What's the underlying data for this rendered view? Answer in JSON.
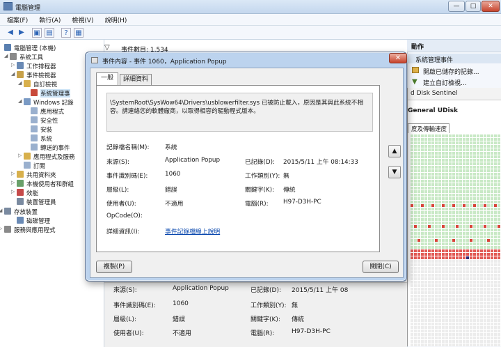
{
  "window": {
    "title": "電腦管理",
    "min": "—",
    "max": "□",
    "close": "✕"
  },
  "menu": [
    "檔案(F)",
    "執行(A)",
    "檢視(V)",
    "說明(H)"
  ],
  "tree": [
    {
      "label": "電腦管理 (本機)",
      "exp": ""
    },
    {
      "label": "系統工具",
      "exp": "◢"
    },
    {
      "label": "工作排程器",
      "exp": "▷"
    },
    {
      "label": "事件檢視器",
      "exp": "◢"
    },
    {
      "label": "自訂檢視",
      "exp": "◢"
    },
    {
      "label": "系統管理事",
      "exp": ""
    },
    {
      "label": "Windows 記錄",
      "exp": "◢"
    },
    {
      "label": "應用程式",
      "exp": ""
    },
    {
      "label": "安全性",
      "exp": ""
    },
    {
      "label": "安裝",
      "exp": ""
    },
    {
      "label": "系統",
      "exp": ""
    },
    {
      "label": "轉送的事件",
      "exp": ""
    },
    {
      "label": "應用程式及服務",
      "exp": "▷"
    },
    {
      "label": "訂閱",
      "exp": ""
    },
    {
      "label": "共用資料夾",
      "exp": "▷"
    },
    {
      "label": "本機使用者和群組",
      "exp": "▷"
    },
    {
      "label": "效能",
      "exp": "▷"
    },
    {
      "label": "裝置管理員",
      "exp": ""
    },
    {
      "label": "存放裝置",
      "exp": "◢"
    },
    {
      "label": "磁碟管理",
      "exp": ""
    },
    {
      "label": "服務與應用程式",
      "exp": "▷"
    }
  ],
  "list": {
    "header": "事件數目: 1,534"
  },
  "background_detail": {
    "source_label": "來源(S):",
    "source_value": "Application Popup",
    "logged_label": "已記錄(D):",
    "logged_value": "2015/5/11 上午 08",
    "eventid_label": "事件識別碼(E):",
    "eventid_value": "1060",
    "task_label": "工作類別(Y):",
    "task_value": "無",
    "level_label": "層級(L):",
    "level_value": "錯誤",
    "keywords_label": "關鍵字(K):",
    "keywords_value": "傳統",
    "user_label": "使用者(U):",
    "user_value": "不適用",
    "computer_label": "電腦(R):",
    "computer_value": "H97-D3H-PC"
  },
  "actions": {
    "title": "動作",
    "section": "系統管理事件",
    "items": [
      "開啟已儲存的記錄...",
      "建立自訂檢視..."
    ],
    "sentinel_title": "d Disk Sentinel",
    "udisk": "General UDisk",
    "udisk_tab": "度及傳輸速度"
  },
  "dialog": {
    "title": "事件內容 - 事件 1060，Application Popup",
    "close": "✕",
    "tabs": [
      "一般",
      "詳細資料"
    ],
    "description": "\\SystemRoot\\SysWow64\\Drivers\\usblowerfilter.sys 已被防止載入，原因是其與此系統不相容。請連絡您的軟體廠商，以取得相容的驅動程式版本。",
    "log_name_label": "記錄檔名稱(M):",
    "log_name_value": "系統",
    "source_label": "來源(S):",
    "source_value": "Application Popup",
    "logged_label": "已記錄(D):",
    "logged_value": "2015/5/11 上午 08:14:33",
    "eventid_label": "事件識別碼(E):",
    "eventid_value": "1060",
    "task_label": "工作類別(Y):",
    "task_value": "無",
    "level_label": "層級(L):",
    "level_value": "錯誤",
    "keywords_label": "關鍵字(K):",
    "keywords_value": "傳統",
    "user_label": "使用者(U):",
    "user_value": "不適用",
    "computer_label": "電腦(R):",
    "computer_value": "H97-D3H-PC",
    "opcode_label": "OpCode(O):",
    "more_info_label": "詳細資訊(I):",
    "more_info_link": "事件記錄檔線上說明",
    "up_arrow": "▲",
    "down_arrow": "▼",
    "copy_button": "複製(P)",
    "close_button": "關閉(C)"
  }
}
